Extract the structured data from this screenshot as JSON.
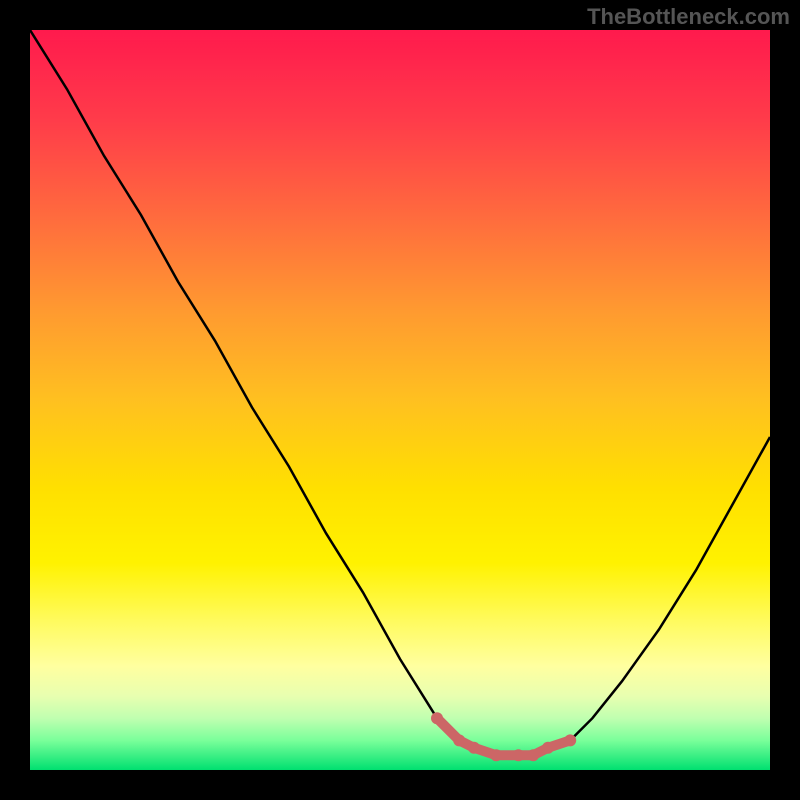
{
  "watermark": "TheBottleneck.com",
  "chart_data": {
    "type": "line",
    "title": "",
    "xlabel": "",
    "ylabel": "",
    "xlim": [
      0,
      100
    ],
    "ylim": [
      0,
      100
    ],
    "series": [
      {
        "name": "curve",
        "x": [
          0,
          5,
          10,
          15,
          20,
          25,
          30,
          35,
          40,
          45,
          50,
          55,
          58,
          60,
          63,
          66,
          68,
          70,
          73,
          76,
          80,
          85,
          90,
          95,
          100
        ],
        "values": [
          100,
          92,
          83,
          75,
          66,
          58,
          49,
          41,
          32,
          24,
          15,
          7,
          4,
          3,
          2,
          2,
          2,
          3,
          4,
          7,
          12,
          19,
          27,
          36,
          45
        ]
      }
    ],
    "highlight": {
      "color": "#cc6666",
      "x": [
        55,
        58,
        60,
        63,
        66,
        68,
        70,
        73
      ],
      "values": [
        7,
        4,
        3,
        2,
        2,
        2,
        3,
        4
      ]
    },
    "gradient_stops": [
      {
        "pos": 0,
        "color": "#ff1a4d"
      },
      {
        "pos": 25,
        "color": "#ff6a3e"
      },
      {
        "pos": 50,
        "color": "#ffc020"
      },
      {
        "pos": 72,
        "color": "#fff200"
      },
      {
        "pos": 90,
        "color": "#e8ffb0"
      },
      {
        "pos": 100,
        "color": "#00e070"
      }
    ]
  }
}
